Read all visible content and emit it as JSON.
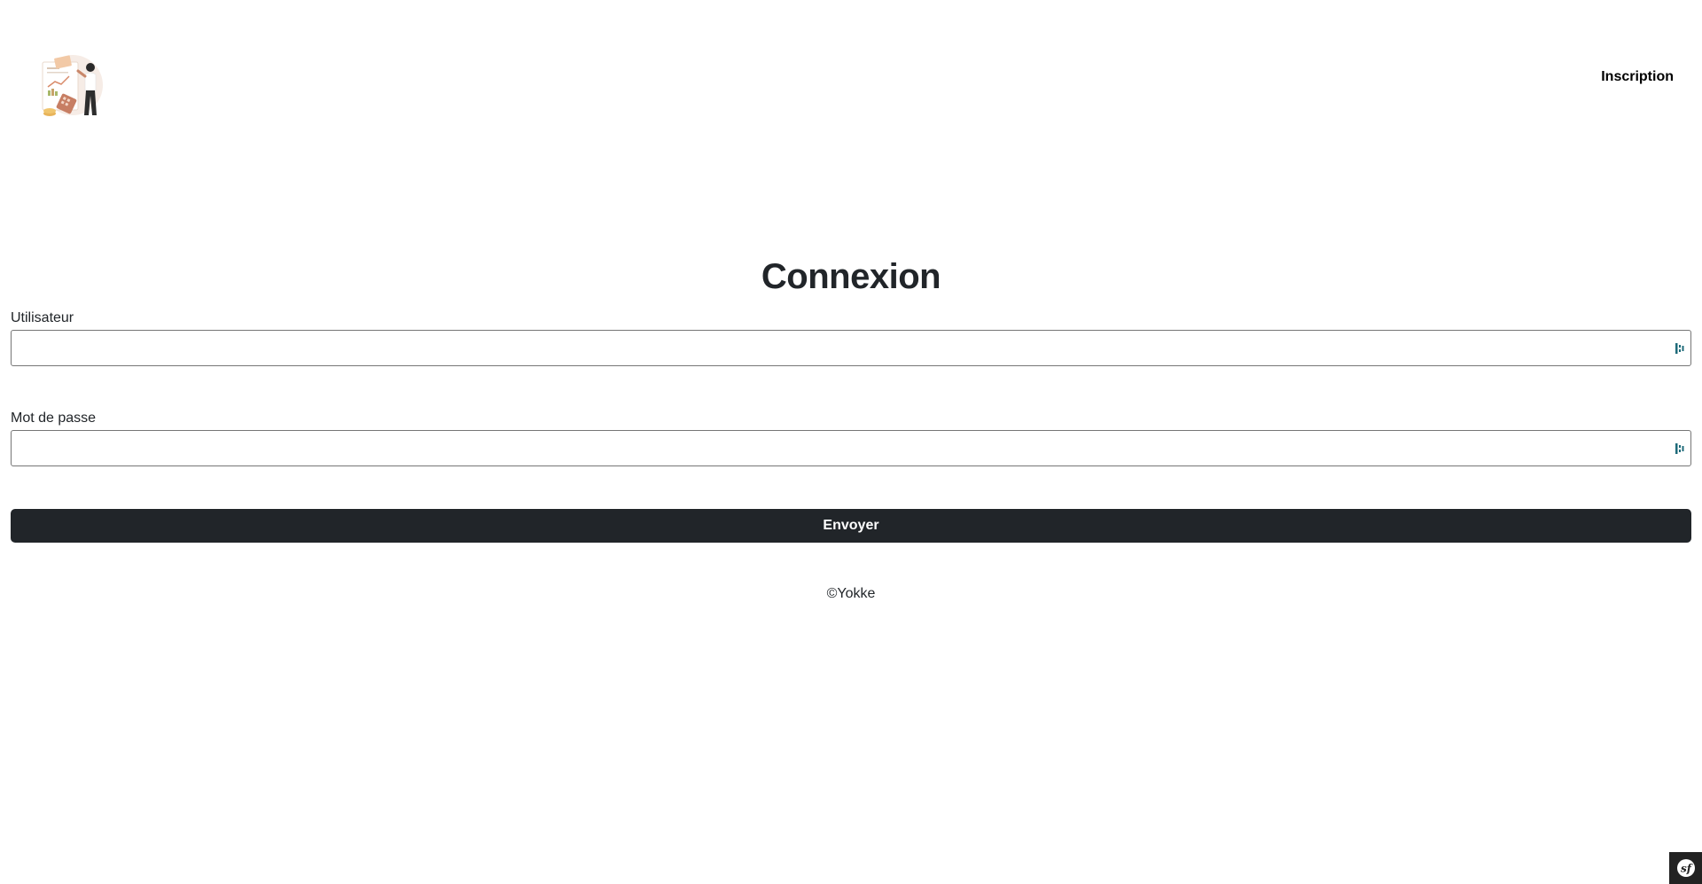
{
  "header": {
    "logo_icon": "accounting-illustration-logo",
    "nav_register_label": "Inscription"
  },
  "form": {
    "title": "Connexion",
    "username_label": "Utilisateur",
    "username_value": "",
    "password_label": "Mot de passe",
    "password_value": "",
    "submit_label": "Envoyer",
    "field_icon": "password-manager-icon"
  },
  "footer": {
    "text": "©Yokke"
  },
  "debug_toolbar": {
    "icon": "symfony-logo-icon"
  },
  "colors": {
    "primary_dark": "#212529",
    "field_icon": "#1f6b7a"
  }
}
